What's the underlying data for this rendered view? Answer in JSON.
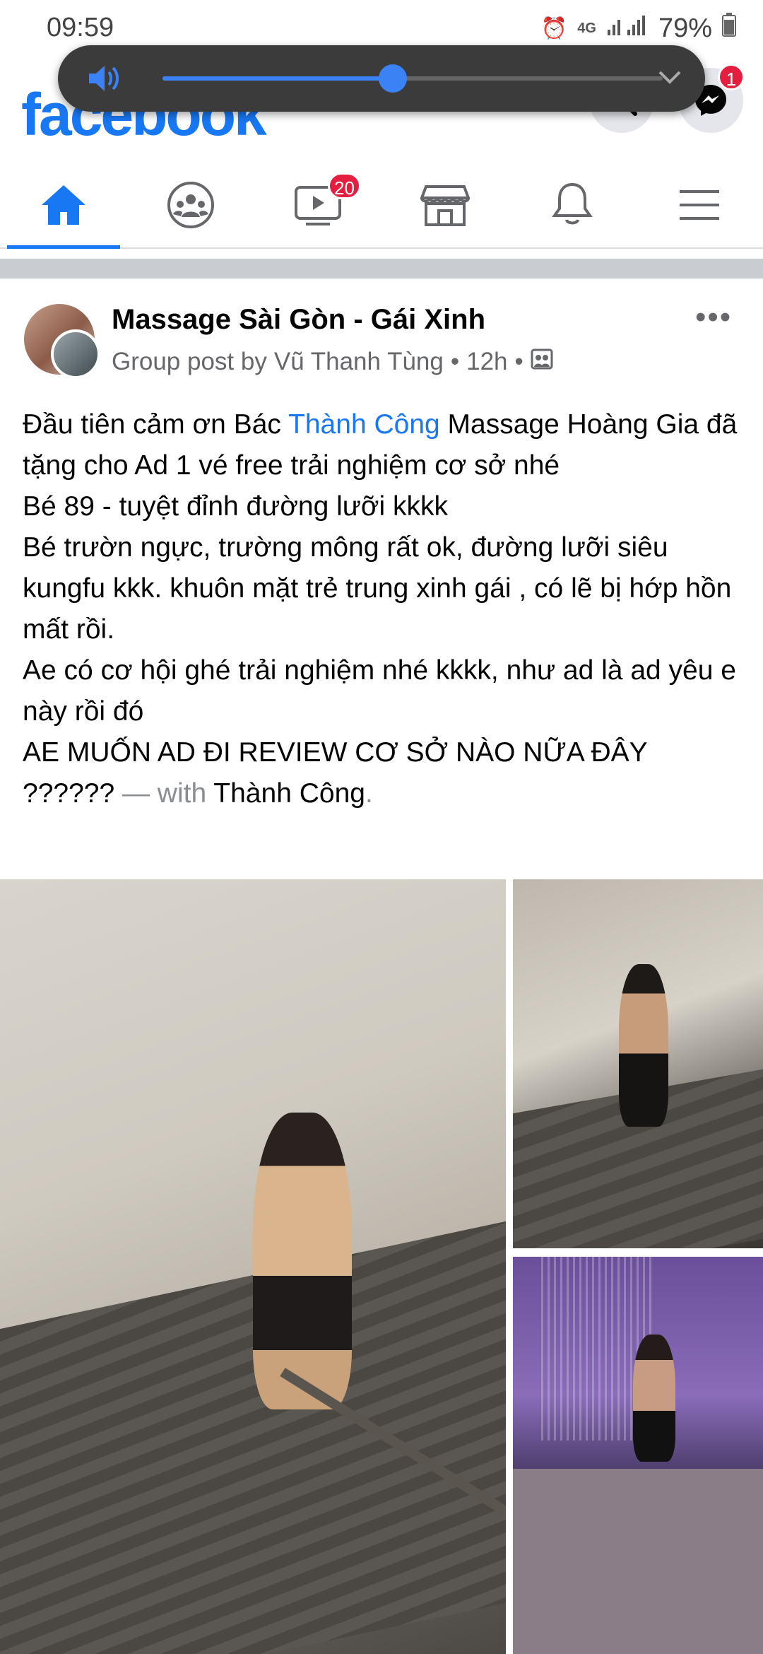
{
  "status_bar": {
    "time": "09:59",
    "network": "4G",
    "battery": "79%"
  },
  "header": {
    "logo": "facebook",
    "messenger_badge": "1"
  },
  "volume_overlay": {
    "level": 0.46,
    "accent": "#3b82f6"
  },
  "tabs": [
    {
      "name": "home",
      "active": true
    },
    {
      "name": "groups",
      "active": false
    },
    {
      "name": "watch",
      "badge": "20",
      "active": false
    },
    {
      "name": "marketplace",
      "active": false
    },
    {
      "name": "notifications",
      "active": false
    },
    {
      "name": "menu",
      "active": false
    }
  ],
  "post": {
    "group_name": "Massage Sài Gòn - Gái Xinh",
    "meta_prefix": "Group post by",
    "author": "Vũ Thanh Tùng",
    "time": "12h",
    "text_part1": "Đầu tiên cảm ơn Bác ",
    "mention1": "Thành Công",
    "text_part2": " Massage Hoàng Gia đã tặng cho Ad 1 vé free trải nghiệm cơ sở nhé\nBé 89 - tuyệt đỉnh đường lưỡi kkkk\nBé trườn ngực, trường mông rất ok, đường lưỡi siêu kungfu kkk. khuôn mặt trẻ trung xinh gái , có lẽ bị hớp hồn mất rồi.\nAe có cơ hội ghé trải nghiệm nhé kkkk, như ad là ad yêu e này rồi đó\nAE MUỐN AD ĐI REVIEW CƠ SỞ NÀO NỮA ĐÂY ??????",
    "with_label": " — with ",
    "tagged": "Thành Công",
    "end": "."
  },
  "colors": {
    "brand": "#1877f2",
    "badge": "#e41e3f",
    "muted": "#65676b"
  }
}
